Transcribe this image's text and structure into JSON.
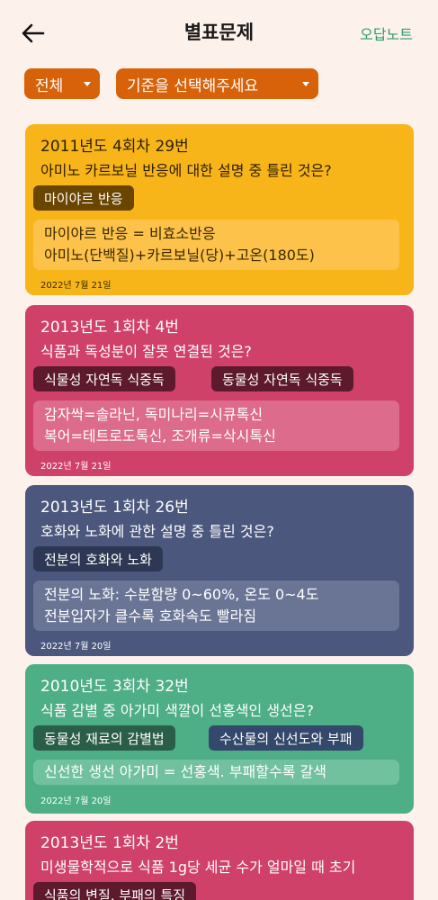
{
  "header": {
    "title": "별표문제",
    "action": "오답노트"
  },
  "filters": {
    "all": "전체",
    "criteria": "기준을 선택해주세요"
  },
  "colors": {
    "accent": "#d7620a",
    "link": "#2e9c6e",
    "background": "#fdf1ec"
  },
  "cards": [
    {
      "title": "2011년도 4회차 29번",
      "question": "아미노 카르보닐 반응에 대한 설명 중 틀린 것은?",
      "tags": [
        "마이야르 반응"
      ],
      "memo": [
        "마이야르 반응 = 비효소반응",
        "아미노(단백질)+카르보닐(당)+고온(180도)"
      ],
      "date": "2022년 7월 21일",
      "color": "#f8b519"
    },
    {
      "title": "2013년도 1회차 4번",
      "question": "식품과 독성분이 잘못 연결된 것은?",
      "tags": [
        "식물성 자연독 식중독",
        "동물성 자연독 식중독"
      ],
      "memo": [
        "감자싹=솔라닌, 독미나리=시큐톡신",
        "복어=테트로도톡신, 조개류=삭시톡신"
      ],
      "date": "2022년 7월 21일",
      "color": "#d0416a"
    },
    {
      "title": "2013년도 1회차 26번",
      "question": "호화와 노화에 관한 설명 중 틀린 것은?",
      "tags": [
        "전분의 호화와 노화"
      ],
      "memo": [
        "전분의 노화: 수분함량 0~60%, 온도 0~4도",
        "전분입자가 클수록 호화속도 빨라짐"
      ],
      "date": "2022년 7월 20일",
      "color": "#4b577c"
    },
    {
      "title": "2010년도 3회차 32번",
      "question": "식품 감별 중 아가미 색깔이 선홍색인 생선은?",
      "tags": [
        "동물성 재료의 감별법",
        "수산물의 신선도와 부패"
      ],
      "memo": [
        "신선한 생선 아가미 = 선홍색. 부패할수록 갈색"
      ],
      "date": "2022년 7월 20일",
      "color": "#4eae86"
    },
    {
      "title": "2013년도 1회차 2번",
      "question": "미생물학적으로 식품 1g당 세균 수가 얼마일 때 초기",
      "tags": [
        "식품의 변질, 부패의 특징"
      ],
      "color": "#d0416a"
    }
  ]
}
